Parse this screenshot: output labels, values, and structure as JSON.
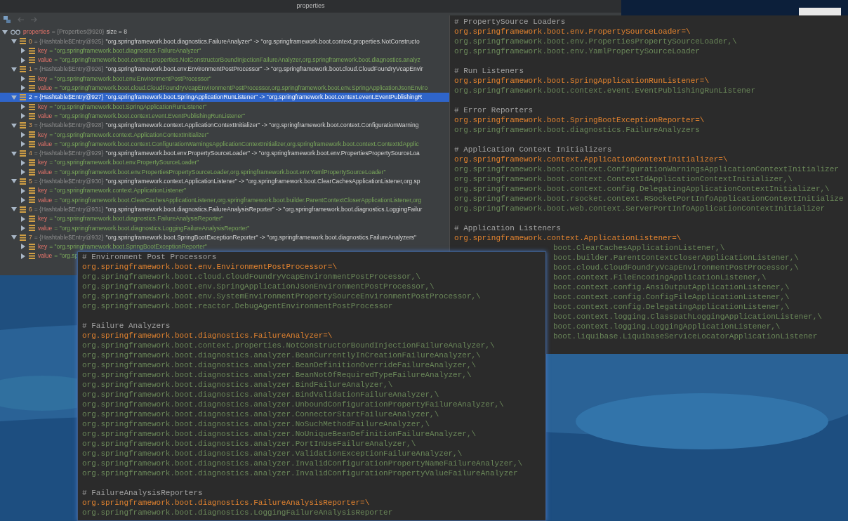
{
  "debugger": {
    "window": {
      "title": "properties"
    },
    "tree": [
      {
        "kind": "watch",
        "name": "properties",
        "type": "= {Properties@920}",
        "extra": "size = 8",
        "expanded": true,
        "selected": false,
        "children": [
          {
            "kind": "entry",
            "name": "0",
            "type": "= {Hashtable$Entry@925}",
            "value": "\"org.springframework.boot.diagnostics.FailureAnalyzer\" -> \"org.springframework.boot.context.properties.NotConstructo",
            "expanded": true,
            "selected": false,
            "children": [
              {
                "kind": "field",
                "name": "key",
                "value": "= \"org.springframework.boot.diagnostics.FailureAnalyzer\"",
                "expanded": false,
                "selected": false
              },
              {
                "kind": "field",
                "name": "value",
                "value": "= \"org.springframework.boot.context.properties.NotConstructorBoundInjectionFailureAnalyzer,org.springframework.boot.diagnostics.analyz",
                "expanded": false,
                "selected": false
              }
            ]
          },
          {
            "kind": "entry",
            "name": "1",
            "type": "= {Hashtable$Entry@926}",
            "value": "\"org.springframework.boot.env.EnvironmentPostProcessor\" -> \"org.springframework.boot.cloud.CloudFoundryVcapEnvir",
            "expanded": true,
            "selected": false,
            "children": [
              {
                "kind": "field",
                "name": "key",
                "value": "= \"org.springframework.boot.env.EnvironmentPostProcessor\"",
                "expanded": false,
                "selected": false
              },
              {
                "kind": "field",
                "name": "value",
                "value": "= \"org.springframework.boot.cloud.CloudFoundryVcapEnvironmentPostProcessor,org.springframework.boot.env.SpringApplicationJsonEnviro",
                "expanded": false,
                "selected": false
              }
            ]
          },
          {
            "kind": "entry",
            "name": "2",
            "type": "= {Hashtable$Entry@927}",
            "value": "\"org.springframework.boot.SpringApplicationRunListener\" -> \"org.springframework.boot.context.event.EventPublishingR",
            "expanded": true,
            "selected": true,
            "children": [
              {
                "kind": "field",
                "name": "key",
                "value": "= \"org.springframework.boot.SpringApplicationRunListener\"",
                "expanded": false,
                "selected": false
              },
              {
                "kind": "field",
                "name": "value",
                "value": "= \"org.springframework.boot.context.event.EventPublishingRunListener\"",
                "expanded": false,
                "selected": false
              }
            ]
          },
          {
            "kind": "entry",
            "name": "3",
            "type": "= {Hashtable$Entry@928}",
            "value": "\"org.springframework.context.ApplicationContextInitializer\" -> \"org.springframework.boot.context.ConfigurationWarning",
            "expanded": true,
            "selected": false,
            "children": [
              {
                "kind": "field",
                "name": "key",
                "value": "= \"org.springframework.context.ApplicationContextInitializer\"",
                "expanded": false,
                "selected": false
              },
              {
                "kind": "field",
                "name": "value",
                "value": "= \"org.springframework.boot.context.ConfigurationWarningsApplicationContextInitializer,org.springframework.boot.context.ContextIdApplic",
                "expanded": false,
                "selected": false
              }
            ]
          },
          {
            "kind": "entry",
            "name": "4",
            "type": "= {Hashtable$Entry@929}",
            "value": "\"org.springframework.boot.env.PropertySourceLoader\" -> \"org.springframework.boot.env.PropertiesPropertySourceLoa",
            "expanded": true,
            "selected": false,
            "children": [
              {
                "kind": "field",
                "name": "key",
                "value": "= \"org.springframework.boot.env.PropertySourceLoader\"",
                "expanded": false,
                "selected": false
              },
              {
                "kind": "field",
                "name": "value",
                "value": "= \"org.springframework.boot.env.PropertiesPropertySourceLoader,org.springframework.boot.env.YamlPropertySourceLoader\"",
                "expanded": false,
                "selected": false
              }
            ]
          },
          {
            "kind": "entry",
            "name": "5",
            "type": "= {Hashtable$Entry@930}",
            "value": "\"org.springframework.context.ApplicationListener\" -> \"org.springframework.boot.ClearCachesApplicationListener,org.sp",
            "expanded": true,
            "selected": false,
            "children": [
              {
                "kind": "field",
                "name": "key",
                "value": "= \"org.springframework.context.ApplicationListener\"",
                "expanded": false,
                "selected": false
              },
              {
                "kind": "field",
                "name": "value",
                "value": "= \"org.springframework.boot.ClearCachesApplicationListener,org.springframework.boot.builder.ParentContextCloserApplicationListener,org",
                "expanded": false,
                "selected": false
              }
            ]
          },
          {
            "kind": "entry",
            "name": "6",
            "type": "= {Hashtable$Entry@931}",
            "value": "\"org.springframework.boot.diagnostics.FailureAnalysisReporter\" -> \"org.springframework.boot.diagnostics.LoggingFailur",
            "expanded": true,
            "selected": false,
            "children": [
              {
                "kind": "field",
                "name": "key",
                "value": "= \"org.springframework.boot.diagnostics.FailureAnalysisReporter\"",
                "expanded": false,
                "selected": false
              },
              {
                "kind": "field",
                "name": "value",
                "value": "= \"org.springframework.boot.diagnostics.LoggingFailureAnalysisReporter\"",
                "expanded": false,
                "selected": false
              }
            ]
          },
          {
            "kind": "entry",
            "name": "7",
            "type": "= {Hashtable$Entry@932}",
            "value": "\"org.springframework.boot.SpringBootExceptionReporter\" -> \"org.springframework.boot.diagnostics.FailureAnalyzers\"",
            "expanded": true,
            "selected": false,
            "children": [
              {
                "kind": "field",
                "name": "key",
                "value": "= \"org.springframework.boot.SpringBootExceptionReporter\"",
                "expanded": false,
                "selected": false
              },
              {
                "kind": "field",
                "name": "value",
                "value": "= \"org.sp",
                "expanded": false,
                "selected": false
              }
            ]
          }
        ]
      }
    ]
  },
  "right_editor": {
    "lines": [
      {
        "kind": "comment",
        "text": "# PropertySource Loaders"
      },
      {
        "kind": "key",
        "text": "org.springframework.boot.env.PropertySourceLoader=\\"
      },
      {
        "kind": "value",
        "text": "org.springframework.boot.env.PropertiesPropertySourceLoader,\\"
      },
      {
        "kind": "value",
        "text": "org.springframework.boot.env.YamlPropertySourceLoader"
      },
      {
        "kind": "blank"
      },
      {
        "kind": "comment",
        "text": "# Run Listeners"
      },
      {
        "kind": "key",
        "text": "org.springframework.boot.SpringApplicationRunListener=\\"
      },
      {
        "kind": "value",
        "text": "org.springframework.boot.context.event.EventPublishingRunListener"
      },
      {
        "kind": "blank"
      },
      {
        "kind": "comment",
        "text": "# Error Reporters"
      },
      {
        "kind": "key",
        "text": "org.springframework.boot.SpringBootExceptionReporter=\\"
      },
      {
        "kind": "value",
        "text": "org.springframework.boot.diagnostics.FailureAnalyzers"
      },
      {
        "kind": "blank"
      },
      {
        "kind": "comment",
        "text": "# Application Context Initializers"
      },
      {
        "kind": "key",
        "text": "org.springframework.context.ApplicationContextInitializer=\\"
      },
      {
        "kind": "value",
        "text": "org.springframework.boot.context.ConfigurationWarningsApplicationContextInitializer"
      },
      {
        "kind": "value",
        "text": "org.springframework.boot.context.ContextIdApplicationContextInitializer,\\"
      },
      {
        "kind": "value",
        "text": "org.springframework.boot.context.config.DelegatingApplicationContextInitializer,\\"
      },
      {
        "kind": "value",
        "text": "org.springframework.boot.rsocket.context.RSocketPortInfoApplicationContextInitialize"
      },
      {
        "kind": "value",
        "text": "org.springframework.boot.web.context.ServerPortInfoApplicationContextInitializer"
      },
      {
        "kind": "blank"
      },
      {
        "kind": "comment",
        "text": "# Application Listeners"
      },
      {
        "kind": "key",
        "text": "org.springframework.context.ApplicationListener=\\"
      },
      {
        "kind": "value_covered",
        "text": "boot.ClearCachesApplicationListener,\\"
      },
      {
        "kind": "value_covered",
        "text": "boot.builder.ParentContextCloserApplicationListener,\\"
      },
      {
        "kind": "value_covered",
        "text": "boot.cloud.CloudFoundryVcapEnvironmentPostProcessor,\\"
      },
      {
        "kind": "value_covered",
        "text": "boot.context.FileEncodingApplicationListener,\\"
      },
      {
        "kind": "value_covered",
        "text": "boot.context.config.AnsiOutputApplicationListener,\\"
      },
      {
        "kind": "value_covered",
        "text": "boot.context.config.ConfigFileApplicationListener,\\"
      },
      {
        "kind": "value_covered",
        "text": "boot.context.config.DelegatingApplicationListener,\\"
      },
      {
        "kind": "value_covered",
        "text": "boot.context.logging.ClasspathLoggingApplicationListener,\\"
      },
      {
        "kind": "value_covered",
        "text": "boot.context.logging.LoggingApplicationListener,\\"
      },
      {
        "kind": "value_covered",
        "text": "boot.liquibase.LiquibaseServiceLocatorApplicationListener"
      }
    ]
  },
  "bottom_editor": {
    "lines": [
      {
        "kind": "comment",
        "text": "# Environment Post Processors"
      },
      {
        "kind": "key",
        "text": "org.springframework.boot.env.EnvironmentPostProcessor=\\"
      },
      {
        "kind": "value",
        "text": "org.springframework.boot.cloud.CloudFoundryVcapEnvironmentPostProcessor,\\"
      },
      {
        "kind": "value",
        "text": "org.springframework.boot.env.SpringApplicationJsonEnvironmentPostProcessor,\\"
      },
      {
        "kind": "value",
        "text": "org.springframework.boot.env.SystemEnvironmentPropertySourceEnvironmentPostProcessor,\\"
      },
      {
        "kind": "value",
        "text": "org.springframework.boot.reactor.DebugAgentEnvironmentPostProcessor"
      },
      {
        "kind": "blank"
      },
      {
        "kind": "comment",
        "text": "# Failure Analyzers"
      },
      {
        "kind": "key",
        "text": "org.springframework.boot.diagnostics.FailureAnalyzer=\\"
      },
      {
        "kind": "value",
        "text": "org.springframework.boot.context.properties.NotConstructorBoundInjectionFailureAnalyzer,\\"
      },
      {
        "kind": "value",
        "text": "org.springframework.boot.diagnostics.analyzer.BeanCurrentlyInCreationFailureAnalyzer,\\"
      },
      {
        "kind": "value",
        "text": "org.springframework.boot.diagnostics.analyzer.BeanDefinitionOverrideFailureAnalyzer,\\"
      },
      {
        "kind": "value",
        "text": "org.springframework.boot.diagnostics.analyzer.BeanNotOfRequiredTypeFailureAnalyzer,\\"
      },
      {
        "kind": "value",
        "text": "org.springframework.boot.diagnostics.analyzer.BindFailureAnalyzer,\\"
      },
      {
        "kind": "value",
        "text": "org.springframework.boot.diagnostics.analyzer.BindValidationFailureAnalyzer,\\"
      },
      {
        "kind": "value",
        "text": "org.springframework.boot.diagnostics.analyzer.UnboundConfigurationPropertyFailureAnalyzer,\\"
      },
      {
        "kind": "value",
        "text": "org.springframework.boot.diagnostics.analyzer.ConnectorStartFailureAnalyzer,\\"
      },
      {
        "kind": "value",
        "text": "org.springframework.boot.diagnostics.analyzer.NoSuchMethodFailureAnalyzer,\\"
      },
      {
        "kind": "value",
        "text": "org.springframework.boot.diagnostics.analyzer.NoUniqueBeanDefinitionFailureAnalyzer,\\"
      },
      {
        "kind": "value",
        "text": "org.springframework.boot.diagnostics.analyzer.PortInUseFailureAnalyzer,\\"
      },
      {
        "kind": "value",
        "text": "org.springframework.boot.diagnostics.analyzer.ValidationExceptionFailureAnalyzer,\\"
      },
      {
        "kind": "value",
        "text": "org.springframework.boot.diagnostics.analyzer.InvalidConfigurationPropertyNameFailureAnalyzer,\\"
      },
      {
        "kind": "value",
        "text": "org.springframework.boot.diagnostics.analyzer.InvalidConfigurationPropertyValueFailureAnalyzer"
      },
      {
        "kind": "blank"
      },
      {
        "kind": "comment",
        "text": "# FailureAnalysisReporters"
      },
      {
        "kind": "key",
        "text": "org.springframework.boot.diagnostics.FailureAnalysisReporter=\\"
      },
      {
        "kind": "value",
        "text": "org.springframework.boot.diagnostics.LoggingFailureAnalysisReporter"
      }
    ]
  }
}
